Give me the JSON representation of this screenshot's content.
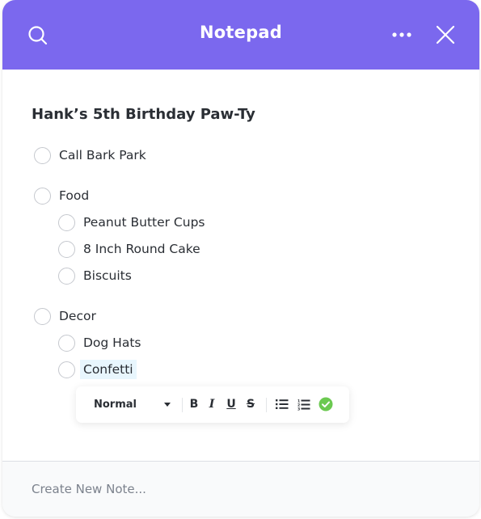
{
  "header": {
    "title": "Notepad",
    "icons": {
      "search": "search-icon",
      "more": "more-horizontal-icon",
      "close": "close-icon"
    },
    "color": "#7b68ee"
  },
  "note": {
    "title": "Hank’s 5th Birthday Paw-Ty",
    "items": [
      {
        "label": "Call Bark Park",
        "level": 0,
        "checked": false
      },
      {
        "label": "Food",
        "level": 0,
        "checked": false
      },
      {
        "label": "Peanut Butter Cups",
        "level": 1,
        "checked": false
      },
      {
        "label": "8 Inch Round Cake",
        "level": 1,
        "checked": false
      },
      {
        "label": "Biscuits",
        "level": 1,
        "checked": false
      },
      {
        "label": "Decor",
        "level": 0,
        "checked": false
      },
      {
        "label": "Dog Hats",
        "level": 1,
        "checked": false
      },
      {
        "label": "Confetti",
        "level": 1,
        "checked": false,
        "selected": true
      }
    ]
  },
  "toolbar": {
    "text_style": "Normal",
    "bold": "B",
    "italic": "I",
    "underline": "U",
    "strikethrough": "S",
    "icons": [
      "bulleted-list-icon",
      "numbered-list-icon",
      "checkmark-circle-icon"
    ],
    "check_color": "#6bc950"
  },
  "footer": {
    "placeholder": "Create New Note..."
  }
}
